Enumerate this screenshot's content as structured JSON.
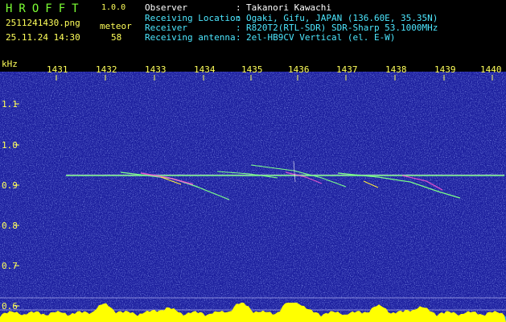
{
  "header": {
    "app_name": "HROFFT",
    "app_version": "1.0.0",
    "file_name": "2511241430.png",
    "datetime": "25.11.24 14:30",
    "detect_type": "meteor",
    "count": "58",
    "info": [
      {
        "label": "Observer",
        "value": "Takanori Kawachi"
      },
      {
        "label": "Receiving Location",
        "value": "Ogaki, Gifu, JAPAN (136.60E, 35.35N)"
      },
      {
        "label": "Receiver",
        "value": "R820T2(RTL-SDR) SDR-Sharp 53.1000MHz"
      },
      {
        "label": "Receiving antenna",
        "value": "2el-HB9CV Vertical (el. E-W)"
      }
    ],
    "separator": ":"
  },
  "axes": {
    "y_unit": "kHz",
    "time_ticks": [
      "1431",
      "1432",
      "1433",
      "1434",
      "1435",
      "1436",
      "1437",
      "1438",
      "1439",
      "1440"
    ],
    "freq_ticks": [
      "1.1",
      "1.0",
      "0.9",
      "0.8",
      "0.7",
      "0.6"
    ]
  },
  "colors": {
    "background": "#000000",
    "spectrum_bg": "#1c1f9e",
    "trace": "#7cff8a",
    "histogram": "#ffff00",
    "axis_text": "#ffff5a",
    "header_label": "#ffffff",
    "header_accent": "#4de7ff",
    "app_name": "#7cff34"
  }
}
